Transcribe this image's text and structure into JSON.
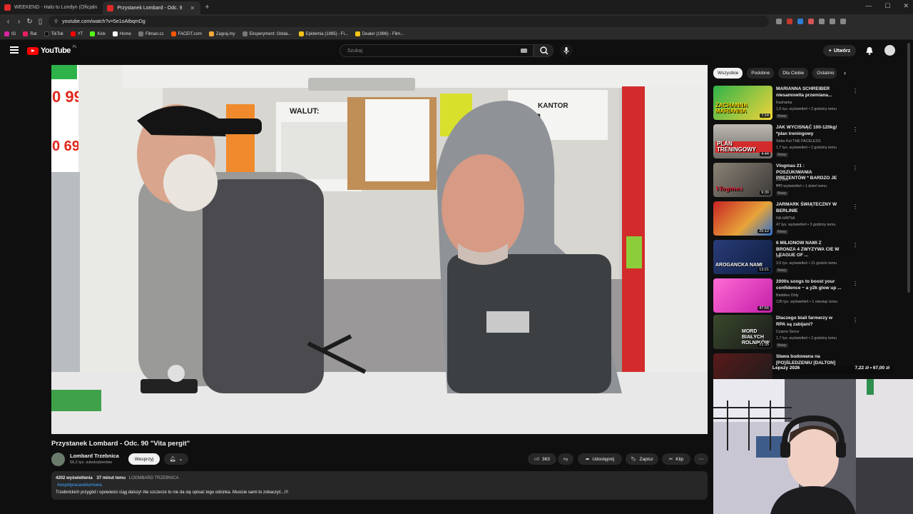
{
  "browser": {
    "tabs": [
      {
        "title": "WEEKEND - Halo tu Londyn (Oficjaln"
      },
      {
        "title": "Przystanek Lombard - Odc. 9",
        "active": true
      }
    ],
    "new_tab_icon": "plus-icon",
    "address": "youtube.com/watch?v=5e1oAtbqmDg",
    "bookmarks": [
      "IG",
      "Rat",
      "TikTok",
      "YT",
      "Kick",
      "Home",
      "Filman.cc",
      "FACEIT.com",
      "Zagraj.my",
      "Eksperyment: Odsła...",
      "Epidemia (1995) - Fi...",
      "Dealer (1996) - Film..."
    ]
  },
  "youtube": {
    "logo_text": "YouTube",
    "logo_region": "PL",
    "search_placeholder": "Szukaj",
    "create_label": "Utwórz",
    "colors": {
      "brand": "#ff0000",
      "background": "#0f0f0f",
      "link": "#3ea6ff"
    }
  },
  "video": {
    "title": "Przystanek Lombard - Odc. 90 \"Vita pergit\"",
    "channel": "Lombard Trzebnica",
    "subscribers": "56,2 tys. subskrybentów",
    "support_label": "Wesprzyj",
    "likes": "363",
    "share_label": "Udostępnij",
    "save_label": "Zapisz",
    "clip_label": "Klip",
    "scene_text": {
      "walut": "WALUT:",
      "kantor": "KANTOR",
      "price1": "0 99",
      "price2": "0 690"
    },
    "description": {
      "views": "4202 wyświetlenia",
      "time": "37 minut temu",
      "channel_upper": "LOOMBARD TRZEBNICA",
      "hashtag": "#współpracareklamowa",
      "text": "Trzebnickich przygód i opowieści ciąg dalszy! Ale szczerze to nie da się opisać tego odcinka. Musicie sami to zobaczyć...!!!"
    }
  },
  "sidebar": {
    "chips": [
      "Wszystkie",
      "Podobne",
      "Dla Ciebie",
      "Ostatnio"
    ],
    "recommendations": [
      {
        "title": "MARIANNA SCHREIBER niesamowita przemiana...",
        "channel": "Kasharka",
        "meta": "1,6 tys. wyświetleń • 2 godziny temu",
        "badge": "Nowy",
        "duration": "7:14",
        "thumb_text": "ZACHANNA MARIANNA"
      },
      {
        "title": "JAK WYCISNĄĆ 100-120kg! *plan treningowy",
        "channel": "Seba Kot THE FACELESS",
        "meta": "1,7 tys. wyświetleń • 2 godziny temu",
        "badge": "Nowy",
        "duration": "4:44",
        "thumb_text": "PLAN TRENINGOWY"
      },
      {
        "title": "Vlogmas 21 : POSZUKIWANIA PREZENTÓW * BARDZO JE ...",
        "channel": "dacoka",
        "meta": "579 wyświetleń • 1 dzień temu",
        "badge": "Nowy",
        "duration": "9:39",
        "thumb_text": "Vlogmas"
      },
      {
        "title": "JARMARK ŚWIĄTECZNY W BERLINIE",
        "channel": "NA HAPSA",
        "meta": "47 tys. wyświetleń • 3 godziny temu",
        "badge": "Nowy",
        "duration": "25:12",
        "thumb_text": ""
      },
      {
        "title": "6 MILIONOW NAMI Z BRONZA 4 ZWYZYWA CIE W LEAGUE OF ...",
        "channel": "Nil",
        "meta": "3,6 tys. wyświetleń • 21 godzin temu",
        "badge": "Nowy",
        "duration": "13:21",
        "thumb_text": "AROGANCKA NAMI"
      },
      {
        "title": "2000s songs to boost your confidence ~ a y2k glow up ...",
        "channel": "Baddies Only",
        "meta": "126 tys. wyświetleń • 1 miesiąc temu",
        "badge": "",
        "duration": "47:56",
        "thumb_text": ""
      },
      {
        "title": "Dlaczego biali farmerzy w RPA są zabijani?",
        "channel": "Czarne Serce",
        "meta": "1,7 tys. wyświetleń • 2 godziny temu",
        "badge": "Nowy",
        "duration": "21:35",
        "thumb_text": "MORD BIAŁYCH ROLNIKÓW"
      },
      {
        "title": "Sława budowana na [PO]ŚLEDZENIU [DALTON]",
        "channel": "",
        "meta": "",
        "badge": "",
        "duration": "",
        "thumb_text": ""
      }
    ]
  },
  "overlay": {
    "ticker_left": "Lepszy 2026",
    "ticker_right": "7,22 zł • 67,00 zł"
  }
}
